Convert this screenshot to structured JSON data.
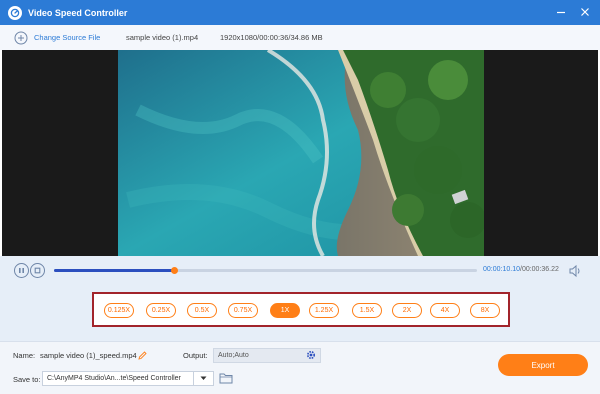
{
  "window": {
    "title": "Video Speed Controller",
    "icons": {
      "app": "gauge-icon",
      "minimize": "minimize-icon",
      "close": "close-icon"
    }
  },
  "source": {
    "change_label": "Change Source File",
    "file_name": "sample video (1).mp4",
    "file_info": "1920x1080/00:00:36/34.86 MB"
  },
  "player": {
    "progress": 0.286,
    "current_time": "00:00:10.10",
    "separator": "/",
    "total_time": "00:00:36.22",
    "icons": {
      "pause": "pause-icon",
      "stop": "stop-icon",
      "volume": "volume-icon"
    }
  },
  "speeds": {
    "options": [
      "0.125X",
      "0.25X",
      "0.5X",
      "0.75X",
      "1X",
      "1.25X",
      "1.5X",
      "2X",
      "4X",
      "8X"
    ],
    "selected": "1X"
  },
  "output": {
    "name_label": "Name:",
    "name_value": "sample video (1)_speed.mp4",
    "output_label": "Output:",
    "output_value": "Auto;Auto",
    "save_label": "Save to:",
    "save_path": "C:\\AnyMP4 Studio\\An...te\\Speed Controller",
    "export_label": "Export"
  },
  "colors": {
    "accent": "#2c7bd6",
    "orange": "#ff7f17",
    "highlight_border": "#a2242b"
  }
}
